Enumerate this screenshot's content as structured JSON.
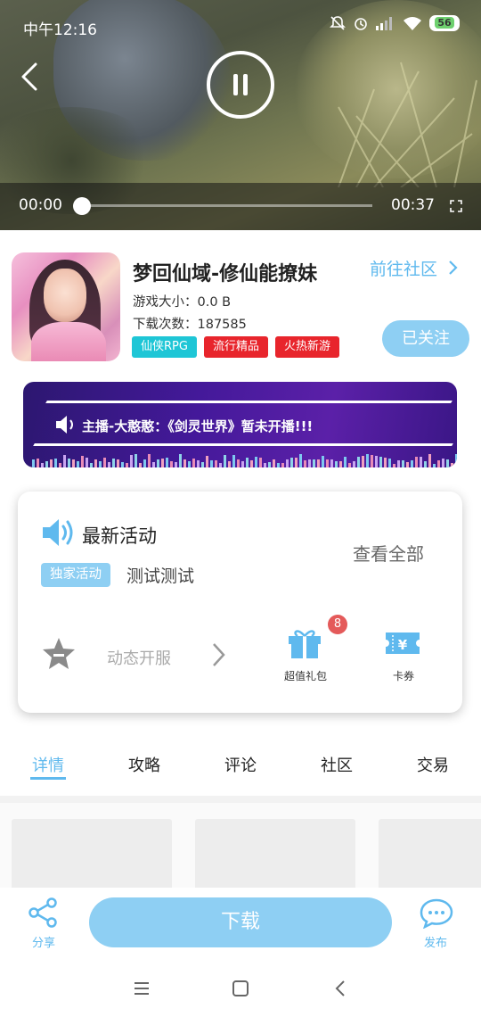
{
  "status_bar": {
    "time": "中午12:16",
    "battery": "56",
    "icons": [
      "mute-icon",
      "alarm-icon",
      "signal-icon",
      "wifi-icon",
      "battery-icon"
    ]
  },
  "video": {
    "current_time": "00:00",
    "total_time": "00:37",
    "progress": 0
  },
  "game": {
    "title": "梦回仙域-修仙能撩妹",
    "size": "游戏大小：0.0 B",
    "downloads": "下载次数：187585",
    "tags": [
      {
        "label": "仙侠RPG",
        "color": "#1ec6d6"
      },
      {
        "label": "流行精品",
        "color": "#e8252c"
      },
      {
        "label": "火热新游",
        "color": "#e8252c"
      }
    ],
    "community_link": "前往社区",
    "follow_label": "已关注"
  },
  "banner": {
    "message": "主播-大憨憨：《剑灵世界》暂未开播!!!"
  },
  "activity": {
    "title": "最新活动",
    "view_all": "查看全部",
    "tag": "独家活动",
    "name": "测试测试",
    "service_label": "动态开服",
    "gift_label": "超值礼包",
    "gift_badge": "8",
    "coupon_label": "卡券"
  },
  "tabs": [
    {
      "label": "详情",
      "active": true
    },
    {
      "label": "攻略",
      "active": false
    },
    {
      "label": "评论",
      "active": false
    },
    {
      "label": "社区",
      "active": false
    },
    {
      "label": "交易",
      "active": false
    }
  ],
  "bottom": {
    "share_label": "分享",
    "download_label": "下载",
    "post_label": "发布"
  },
  "colors": {
    "accent": "#5fb9ee",
    "button": "#8ecff3",
    "banner": "#44199a"
  }
}
